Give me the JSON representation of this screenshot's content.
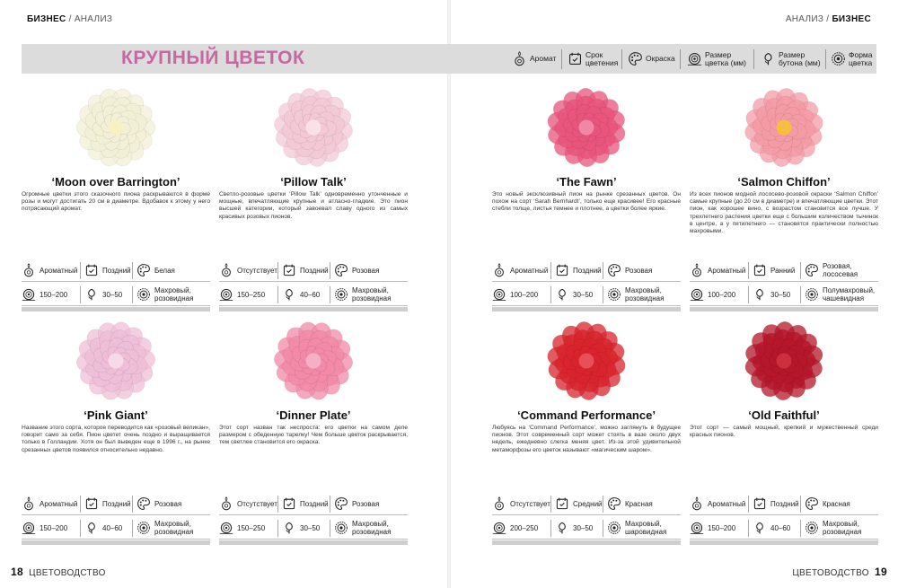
{
  "header": {
    "left": {
      "section": "БИЗНЕС",
      "sub": "АНАЛИЗ"
    },
    "right": {
      "section": "БИЗНЕС",
      "sub": "АНАЛИЗ"
    }
  },
  "title": "КРУПНЫЙ ЦВЕТОК",
  "legend": [
    {
      "icon": "aroma-icon",
      "label": "Аромат"
    },
    {
      "icon": "bloom-time-icon",
      "label": "Срок\nцветения"
    },
    {
      "icon": "palette-icon",
      "label": "Окраска"
    },
    {
      "icon": "flower-size-icon",
      "label": "Размер\nцветка (мм)"
    },
    {
      "icon": "bud-size-icon",
      "label": "Размер\nбутона (мм)"
    },
    {
      "icon": "flower-shape-icon",
      "label": "Форма\nцветка"
    }
  ],
  "colors": {
    "accent": "#c46aa2",
    "band": "#dcdcdc"
  },
  "cards": [
    {
      "name": "‘Moon over Barrington’",
      "color": "#f3f0d8",
      "center": "#f5f1c0",
      "text": "Огромные цветки этого сказочного пиона раскрываются в форме розы и могут достигать 20 см в диаметре. Вдобавок к этому у него потрясающий аромат.",
      "aroma": "Ароматный",
      "time": "Поздний",
      "paint": "Белая",
      "size": "150–200",
      "bud": "30–50",
      "shape": "Махровый, розовидная"
    },
    {
      "name": "‘Pillow Talk’",
      "color": "#f3c9d6",
      "center": "#f9e3ea",
      "text": "Светло-розовые цветки ‘Pillow Talk’ одновременно утонченные и мощные, впечатляющие крупные и атласно-гладкие. Это пион высшей категории, который завоевал славу одного из самых красивых розовых пионов.",
      "aroma": "Отсутствует",
      "time": "Поздний",
      "paint": "Розовая",
      "size": "150–250",
      "bud": "40–60",
      "shape": "Махровый, розовидная"
    },
    {
      "name": "‘The Fawn’",
      "color": "#e9557c",
      "center": "#f08aa7",
      "text": "Это новый эксклюзивный пион на рынке срезанных цветов. Он похож на сорт ‘Sarah Bernhardt’, только еще красивее! Его красные стебли толще, листья темнее и плотнее, а цветки более яркие.",
      "aroma": "Ароматный",
      "time": "Поздний",
      "paint": "Розовая",
      "size": "100–200",
      "bud": "30–50",
      "shape": "Махровый, розовидная"
    },
    {
      "name": "‘Salmon Chiffon’",
      "color": "#f49ba6",
      "center": "#f7c13a",
      "text": "Из всех пионов модной лососево-розовой окраски ‘Salmon Chiffon’ самые крупные (до 20 см в диаметре) и впечатляющие цветки. Этот пион, как хорошее вино, с возрастом становится все лучше. У трехлетнего растения цветки еще с большим количеством тычинок в центре, а у пятилетнего — становятся практически полностью махровыми.",
      "aroma": "Ароматный",
      "time": "Ранний",
      "paint": "Розовая, лососевая",
      "size": "100–200",
      "bud": "30–50",
      "shape": "Полумахровый, чашевидная"
    },
    {
      "name": "‘Pink Giant’",
      "color": "#efbfd8",
      "center": "#f6dbe9",
      "text": "Название этого сорта, которое переводится как «розовый великан», говорит само за себя. Пион цветет очень поздно и выращивается только в Голландии. Хотя он был выведен еще в 1996 г., на рынке срезанных цветов появился относительно недавно.",
      "aroma": "Ароматный",
      "time": "Поздний",
      "paint": "Розовая",
      "size": "150–200",
      "bud": "40–60",
      "shape": "Махровый, розовидная"
    },
    {
      "name": "‘Dinner Plate’",
      "color": "#f28aa8",
      "center": "#f6b2c6",
      "text": "Этот сорт назван так неспроста: его цветки на самом деле размером с обеденную тарелку! Чем больше цветок раскрывается, тем светлее становится его окраска.",
      "aroma": "Отсутствует",
      "time": "Поздний",
      "paint": "Розовая",
      "size": "150–250",
      "bud": "30–50",
      "shape": "Махровый, розовидная"
    },
    {
      "name": "‘Command Performance’",
      "color": "#d9242d",
      "center": "#e9525a",
      "text": "Любуясь на ‘Command Performance’, можно заглянуть в будущее пионов. Этот современный сорт может стоять в вазе около двух недель, ежедневно слегка меняя цвет. Из-за этой удивительной метаморфозы его цветок называют «магическим шаром».",
      "aroma": "Отсутствует",
      "time": "Средний",
      "paint": "Красная",
      "size": "200–250",
      "bud": "30–50",
      "shape": "Махровый, шаровидная"
    },
    {
      "name": "‘Old Faithful’",
      "color": "#b5162a",
      "center": "#d0303f",
      "text": "Этот сорт — самый мощный, крепкий и мужественный среди красных пионов.",
      "aroma": "Ароматный",
      "time": "Поздний",
      "paint": "Красная",
      "size": "150–200",
      "bud": "40–60",
      "shape": "Махровый, розовидная"
    }
  ],
  "footer": {
    "left_num": "18",
    "left_label": "ЦВЕТОВОДСТВО",
    "right_label": "ЦВЕТОВОДСТВО",
    "right_num": "19"
  }
}
